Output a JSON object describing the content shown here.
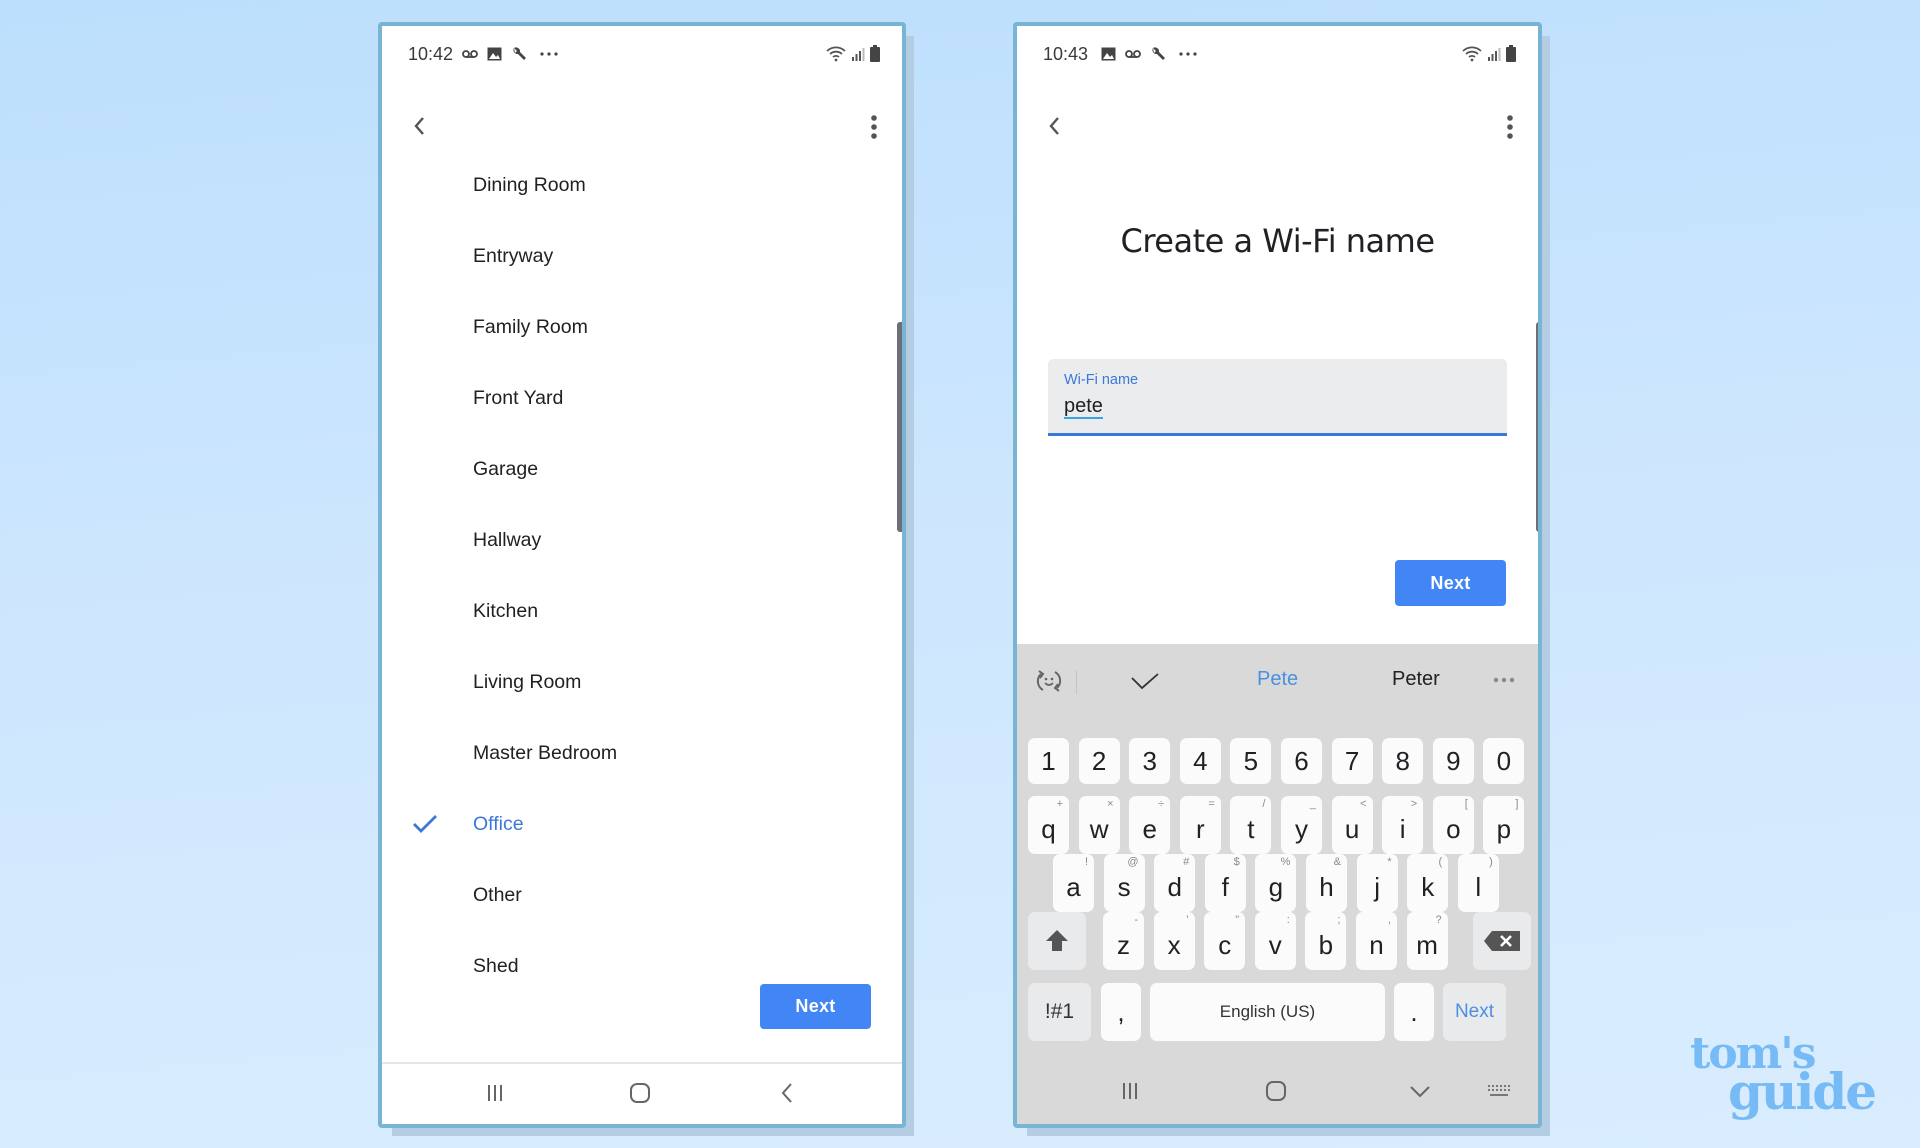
{
  "left_screen": {
    "status": {
      "time": "10:42",
      "icons_left": [
        "voicemail-icon",
        "image-icon",
        "wrench-icon",
        "more-horiz-icon"
      ],
      "icons_right": [
        "wifi-icon",
        "signal-icon",
        "battery-icon"
      ]
    },
    "rooms": [
      {
        "label": "Dining Room",
        "selected": false
      },
      {
        "label": "Entryway",
        "selected": false
      },
      {
        "label": "Family Room",
        "selected": false
      },
      {
        "label": "Front Yard",
        "selected": false
      },
      {
        "label": "Garage",
        "selected": false
      },
      {
        "label": "Hallway",
        "selected": false
      },
      {
        "label": "Kitchen",
        "selected": false
      },
      {
        "label": "Living Room",
        "selected": false
      },
      {
        "label": "Master Bedroom",
        "selected": false
      },
      {
        "label": "Office",
        "selected": true
      },
      {
        "label": "Other",
        "selected": false
      },
      {
        "label": "Shed",
        "selected": false
      }
    ],
    "next_label": "Next"
  },
  "right_screen": {
    "status": {
      "time": "10:43",
      "icons_left": [
        "image-icon",
        "voicemail-icon",
        "wrench-icon",
        "more-horiz-icon"
      ],
      "icons_right": [
        "wifi-icon",
        "signal-icon",
        "battery-icon"
      ]
    },
    "title": "Create a Wi-Fi name",
    "field": {
      "label": "Wi-Fi name",
      "value": "pete"
    },
    "next_label": "Next",
    "keyboard": {
      "suggestions": [
        "Pete",
        "Peter"
      ],
      "number_row": [
        "1",
        "2",
        "3",
        "4",
        "5",
        "6",
        "7",
        "8",
        "9",
        "0"
      ],
      "row_q": [
        [
          "q",
          "+"
        ],
        [
          "w",
          "×"
        ],
        [
          "e",
          "÷"
        ],
        [
          "r",
          "="
        ],
        [
          "t",
          "/"
        ],
        [
          "y",
          "_"
        ],
        [
          "u",
          "<"
        ],
        [
          "i",
          ">"
        ],
        [
          "o",
          "["
        ],
        [
          "p",
          "]"
        ]
      ],
      "row_a": [
        [
          "a",
          "!"
        ],
        [
          "s",
          "@"
        ],
        [
          "d",
          "#"
        ],
        [
          "f",
          "$"
        ],
        [
          "g",
          "%"
        ],
        [
          "h",
          "&"
        ],
        [
          "j",
          "*"
        ],
        [
          "k",
          "("
        ],
        [
          "l",
          ")"
        ]
      ],
      "row_z": [
        [
          "z",
          "-"
        ],
        [
          "x",
          "'"
        ],
        [
          "c",
          "\""
        ],
        [
          "v",
          ":"
        ],
        [
          "b",
          ";"
        ],
        [
          "n",
          ","
        ],
        [
          "m",
          "?"
        ]
      ],
      "symbols_label": "!#1",
      "comma_label": ",",
      "space_label": "English (US)",
      "period_label": ".",
      "action_label": "Next"
    }
  },
  "watermark": {
    "line1": "tom's",
    "line2": "guide"
  },
  "colors": {
    "accent": "#4285f4",
    "selected": "#3c78d8",
    "keyboard_bg": "#d9d9d9",
    "frame": "#78b4d4"
  }
}
